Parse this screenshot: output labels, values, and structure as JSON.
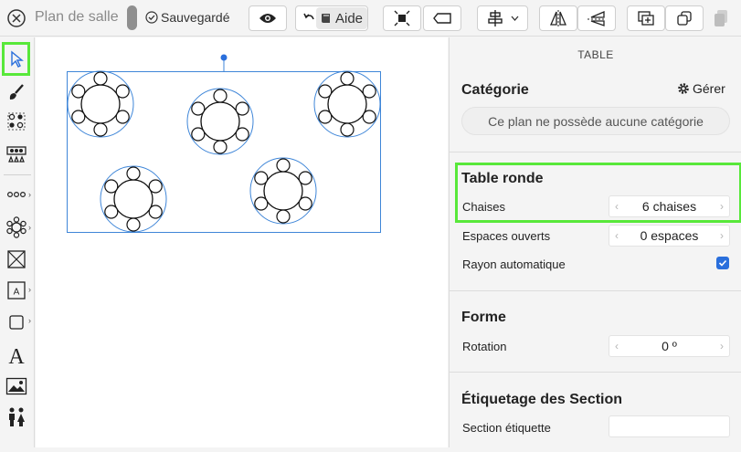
{
  "header": {
    "title": "Plan de salle",
    "saved_status": "Sauvegardé",
    "help_label": "Aide"
  },
  "panel": {
    "title": "TABLE",
    "category": {
      "heading": "Catégorie",
      "manage_label": "Gérer",
      "empty_message": "Ce plan ne possède aucune catégorie"
    },
    "round_table": {
      "heading": "Table ronde",
      "chairs_label": "Chaises",
      "chairs_value": "6",
      "chairs_unit": "chaises",
      "open_spaces_label": "Espaces ouverts",
      "open_spaces_value": "0",
      "open_spaces_unit": "espaces",
      "auto_radius_label": "Rayon automatique",
      "auto_radius_checked": true
    },
    "shape": {
      "heading": "Forme",
      "rotation_label": "Rotation",
      "rotation_value": "0 º"
    },
    "section_labeling": {
      "heading": "Étiquetage des Section",
      "section_label_label": "Section étiquette",
      "section_label_value": ""
    }
  },
  "colors": {
    "accent": "#2a6fdc",
    "highlight": "#58e83a",
    "selection": "#3f86d8"
  },
  "tools": [
    "select-arrow-icon",
    "brush-icon",
    "seat-group-icon",
    "section-icon",
    "row-seats-icon",
    "round-table-icon",
    "rect-table-icon",
    "text-box-icon",
    "shape-icon",
    "text-icon",
    "image-icon",
    "people-icon"
  ]
}
